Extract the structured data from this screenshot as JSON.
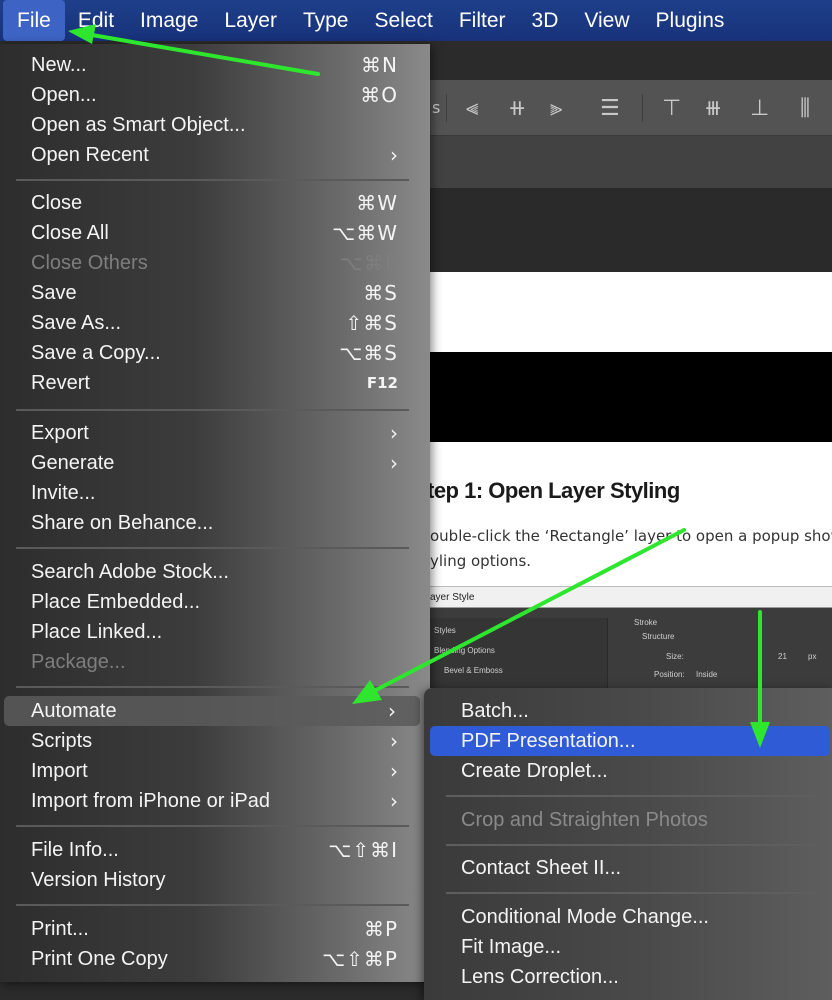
{
  "menubar": {
    "items": [
      "File",
      "Edit",
      "Image",
      "Layer",
      "Type",
      "Select",
      "Filter",
      "3D",
      "View",
      "Plugins"
    ]
  },
  "file_menu": {
    "items": [
      {
        "label": "New...",
        "shortcut": "⌘N"
      },
      {
        "label": "Open...",
        "shortcut": "⌘O"
      },
      {
        "label": "Open as Smart Object...",
        "shortcut": ""
      },
      {
        "label": "Open Recent",
        "shortcut": "",
        "submenu": true
      },
      {
        "label": "Close",
        "shortcut": "⌘W"
      },
      {
        "label": "Close All",
        "shortcut": "⌥⌘W"
      },
      {
        "label": "Close Others",
        "shortcut": "⌥⌘P",
        "disabled": true
      },
      {
        "label": "Save",
        "shortcut": "⌘S"
      },
      {
        "label": "Save As...",
        "shortcut": "⇧⌘S"
      },
      {
        "label": "Save a Copy...",
        "shortcut": "⌥⌘S"
      },
      {
        "label": "Revert",
        "shortcut": "F12"
      },
      {
        "label": "Export",
        "shortcut": "",
        "submenu": true
      },
      {
        "label": "Generate",
        "shortcut": "",
        "submenu": true
      },
      {
        "label": "Invite...",
        "shortcut": ""
      },
      {
        "label": "Share on Behance...",
        "shortcut": ""
      },
      {
        "label": "Search Adobe Stock...",
        "shortcut": ""
      },
      {
        "label": "Place Embedded...",
        "shortcut": ""
      },
      {
        "label": "Place Linked...",
        "shortcut": ""
      },
      {
        "label": "Package...",
        "shortcut": "",
        "disabled": true
      },
      {
        "label": "Automate",
        "shortcut": "",
        "submenu": true,
        "highlighted": true
      },
      {
        "label": "Scripts",
        "shortcut": "",
        "submenu": true
      },
      {
        "label": "Import",
        "shortcut": "",
        "submenu": true
      },
      {
        "label": "Import from iPhone or iPad",
        "shortcut": "",
        "submenu": true
      },
      {
        "label": "File Info...",
        "shortcut": "⌥⇧⌘I"
      },
      {
        "label": "Version History",
        "shortcut": ""
      },
      {
        "label": "Print...",
        "shortcut": "⌘P"
      },
      {
        "label": "Print One Copy",
        "shortcut": "⌥⇧⌘P"
      }
    ],
    "chevron": "›"
  },
  "automate_submenu": {
    "items": [
      {
        "label": "Batch..."
      },
      {
        "label": "PDF Presentation...",
        "selected": true
      },
      {
        "label": "Create Droplet..."
      },
      {
        "label": "Crop and Straighten Photos",
        "disabled": true
      },
      {
        "label": "Contact Sheet II..."
      },
      {
        "label": "Conditional Mode Change..."
      },
      {
        "label": "Fit Image..."
      },
      {
        "label": "Lens Correction..."
      }
    ]
  },
  "background_doc": {
    "step_title": "tep 1: Open Layer Styling",
    "step_line1": "ouble-click the ‘Rectangle’ layer to open a popup showin",
    "step_line2": "yling options.",
    "dialog_title": "ayer Style",
    "dialog_styles": "Styles",
    "dialog_blending": "Blending Options",
    "dialog_bevel": "Bevel & Emboss",
    "dialog_stroke": "Stroke",
    "dialog_structure": "Structure",
    "dialog_size": "Size:",
    "dialog_size_value": "21",
    "dialog_size_unit": "px",
    "dialog_position": "Position:",
    "dialog_position_value": "Inside",
    "options_partial": "s"
  },
  "colors": {
    "menubar": "#1f3f8a",
    "selection": "#2f5bd6",
    "annotation_arrow": "#2ee62e"
  }
}
